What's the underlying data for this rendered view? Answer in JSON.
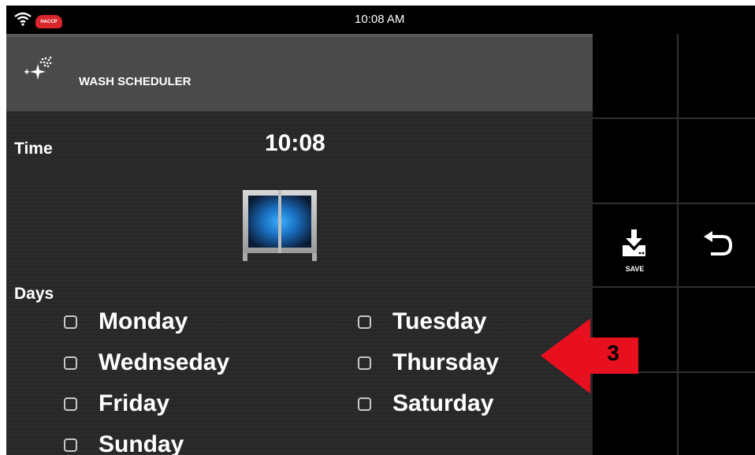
{
  "status_bar": {
    "clock": "10:08 AM",
    "badge": "HACCP",
    "wifi_icon": "wifi-icon"
  },
  "header": {
    "title": "WASH SCHEDULER",
    "icon": "wash-sparkle-icon"
  },
  "schedule": {
    "time_label": "Time",
    "time_value": "10:08",
    "time_button_icon": "oven-glass-icon",
    "days_label": "Days",
    "days": {
      "monday": {
        "label": "Monday",
        "checked": false
      },
      "tuesday": {
        "label": "Tuesday",
        "checked": false
      },
      "wednesday": {
        "label": "Wednseday",
        "checked": false
      },
      "thursday": {
        "label": "Thursday",
        "checked": false
      },
      "friday": {
        "label": "Friday",
        "checked": false
      },
      "saturday": {
        "label": "Saturday",
        "checked": false
      },
      "sunday": {
        "label": "Sunday",
        "checked": false
      }
    }
  },
  "sidebar": {
    "save_label": "SAVE",
    "save_icon": "download-save-icon",
    "back_icon": "back-arrow-icon"
  },
  "annotation": {
    "callout_number": "3",
    "arrow_color": "#e8101e"
  },
  "colors": {
    "badge_red": "#d8262b",
    "title_bar": "#4a4a4a",
    "accent_blue": "#1f8be0"
  }
}
